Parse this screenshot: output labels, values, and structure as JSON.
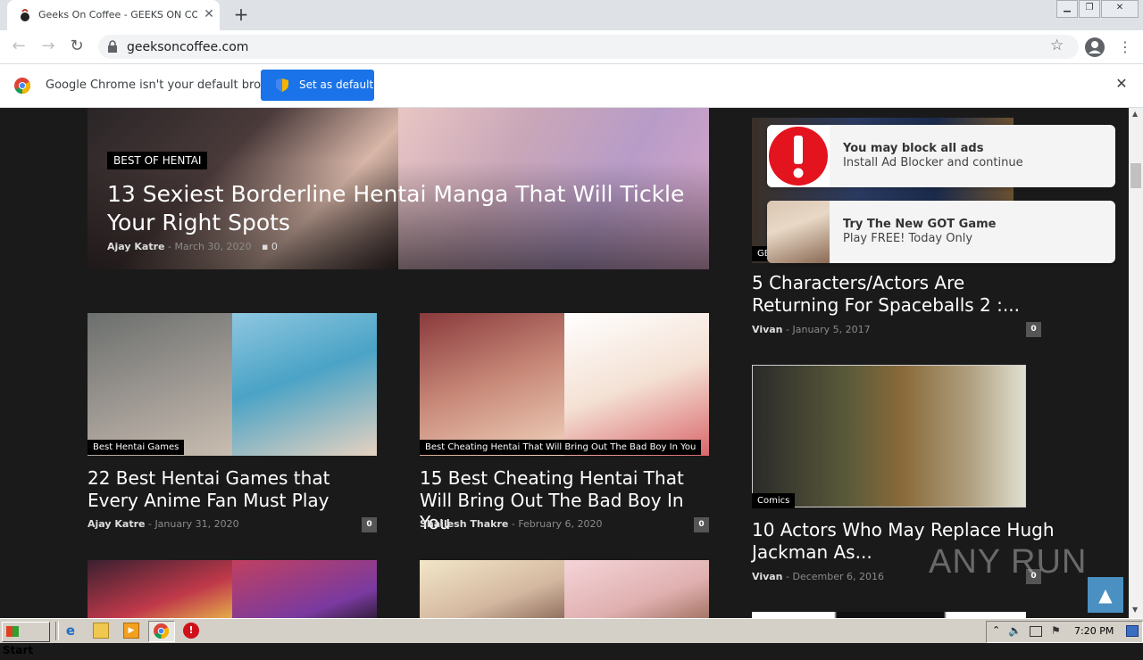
{
  "browser": {
    "tab": {
      "title": "Geeks On Coffee - GEEKS ON COFFEE",
      "close_label": "✕"
    },
    "new_tab_label": "+",
    "url": "geeksoncoffee.com",
    "infobar": {
      "message": "Google Chrome isn't your default browser",
      "button_label": "Set as default",
      "close_label": "✕"
    }
  },
  "featured": {
    "category": "BEST OF HENTAI",
    "title": "13 Sexiest Borderline Hentai Manga That Will Tickle Your Right Spots",
    "author": "Ajay Katre",
    "date": "March 30, 2020",
    "comments": "0"
  },
  "articles": [
    {
      "category": "Best Hentai Games",
      "title": "22 Best Hentai Games that Every Anime Fan Must Play",
      "author": "Ajay Katre",
      "date": "January 31, 2020",
      "comments": "0"
    },
    {
      "category": "Best Cheating Hentai That Will Bring Out The Bad Boy In You",
      "title": "15 Best Cheating Hentai That Will Bring Out The Bad Boy In You",
      "author": "Shailesh Thakre",
      "date": "February 6, 2020",
      "comments": "0"
    }
  ],
  "sidebar": [
    {
      "category": "GE",
      "title": "5 Characters/Actors Are Returning For Spaceballs 2 :...",
      "author": "Vivan",
      "date": "January 5, 2017",
      "comments": "0"
    },
    {
      "category": "Comics",
      "title": "10 Actors Who May Replace Hugh Jackman As...",
      "author": "Vivan",
      "date": "December 6, 2016",
      "comments": "0"
    }
  ],
  "notifications": [
    {
      "title": "You may block all ads",
      "text": "Install Ad Blocker and continue"
    },
    {
      "title": "Try The New GOT Game",
      "text": "Play FREE! Today Only"
    }
  ],
  "watermark": "ANY RUN",
  "taskbar": {
    "start_label": "Start",
    "clock": "7:20 PM"
  }
}
